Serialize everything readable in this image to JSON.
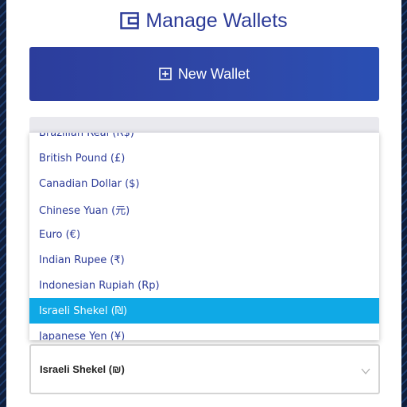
{
  "title": {
    "icon": "wallet-icon",
    "text": "Manage Wallets"
  },
  "new_wallet_button": {
    "icon": "plus-square-icon",
    "label": "New Wallet"
  },
  "currency_dropdown": {
    "options": [
      {
        "label": "Brazilian Real (R$)"
      },
      {
        "label": "British Pound (£)"
      },
      {
        "label": "Canadian Dollar ($)"
      },
      {
        "label": "Chinese Yuan (元)"
      },
      {
        "label": "Euro (€)"
      },
      {
        "label": "Indian Rupee (₹)"
      },
      {
        "label": "Indonesian Rupiah (Rp)"
      },
      {
        "label": "Israeli Shekel (₪)"
      },
      {
        "label": "Japanese Yen (¥)"
      }
    ],
    "highlighted": "Israeli Shekel (₪)"
  },
  "currency_select": {
    "selected_value": "Israeli Shekel (₪)",
    "icon": "chevron-down-icon"
  },
  "colors": {
    "accent": "#2b3a97",
    "highlight": "#0fa9e6",
    "background": "#0f1d3a"
  }
}
